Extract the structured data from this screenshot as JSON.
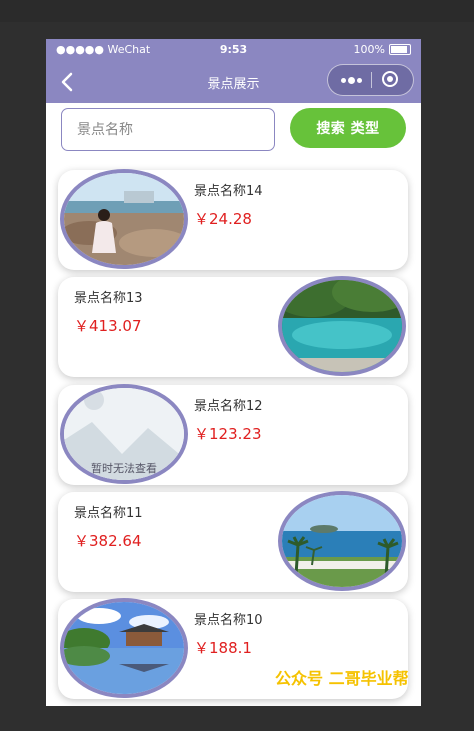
{
  "status_bar": {
    "carrier": "●●●●● WeChat",
    "time": "9:53",
    "battery": "100%"
  },
  "nav": {
    "title": "景点展示"
  },
  "search": {
    "placeholder": "景点名称",
    "button_label": "搜索  类型"
  },
  "items": [
    {
      "name": "景点名称14",
      "price": "￥24.28",
      "image": "beach-photo",
      "side": "left"
    },
    {
      "name": "景点名称13",
      "price": "￥413.07",
      "image": "lake-photo",
      "side": "right"
    },
    {
      "name": "景点名称12",
      "price": "￥123.23",
      "image": "placeholder",
      "side": "left",
      "caption": "暂时无法查看"
    },
    {
      "name": "景点名称11",
      "price": "￥382.64",
      "image": "island-photo",
      "side": "right"
    },
    {
      "name": "景点名称10",
      "price": "￥188.1",
      "image": "pavilion-photo",
      "side": "left"
    }
  ],
  "watermark": "公众号 二哥毕业帮",
  "colors": {
    "accent": "#8b87c1",
    "search_button": "#67c23a",
    "price": "#e02020",
    "watermark": "#f5c200"
  }
}
